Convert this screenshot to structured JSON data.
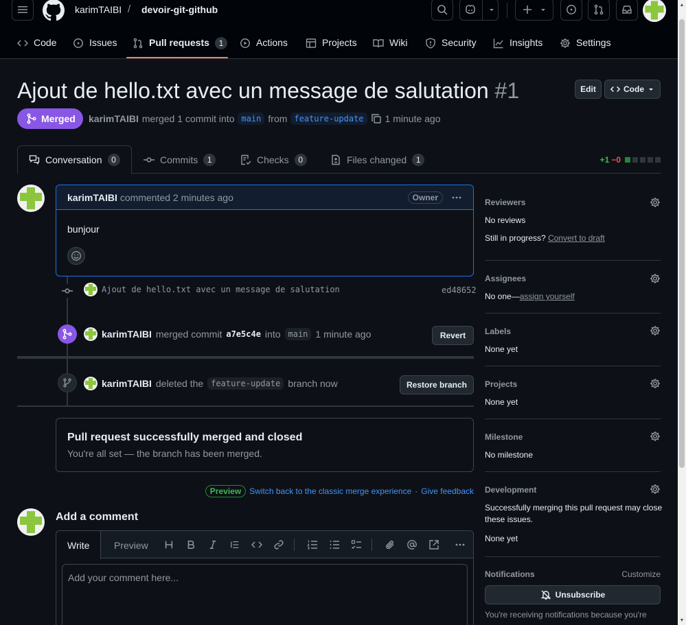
{
  "header": {
    "owner": "karimTAIBI",
    "separator": "/",
    "repo": "devoir-git-github"
  },
  "nav": {
    "items": [
      {
        "label": "Code",
        "icon": "code-icon"
      },
      {
        "label": "Issues",
        "icon": "issue-icon"
      },
      {
        "label": "Pull requests",
        "icon": "pull-request-icon",
        "count": "1"
      },
      {
        "label": "Actions",
        "icon": "play-icon"
      },
      {
        "label": "Projects",
        "icon": "table-icon"
      },
      {
        "label": "Wiki",
        "icon": "book-icon"
      },
      {
        "label": "Security",
        "icon": "shield-icon"
      },
      {
        "label": "Insights",
        "icon": "graph-icon"
      },
      {
        "label": "Settings",
        "icon": "gear-icon"
      }
    ]
  },
  "pr": {
    "title": "Ajout de hello.txt avec un message de salutation",
    "number": "#1",
    "edit_label": "Edit",
    "code_label": "Code",
    "state": "Merged",
    "author": "karimTAIBI",
    "meta_text1": "merged 1 commit into",
    "base_branch": "main",
    "meta_from": "from",
    "head_branch": "feature-update",
    "meta_time": "1 minute ago"
  },
  "tabs": [
    {
      "label": "Conversation",
      "count": "0"
    },
    {
      "label": "Commits",
      "count": "1"
    },
    {
      "label": "Checks",
      "count": "0"
    },
    {
      "label": "Files changed",
      "count": "1"
    }
  ],
  "diffstat": {
    "additions": "+1",
    "deletions": "−0"
  },
  "comment": {
    "author": "karimTAIBI",
    "action": "commented 2 minutes ago",
    "badge": "Owner",
    "body": "bunjour"
  },
  "timeline": {
    "commit_message": "Ajout de hello.txt avec un message de salutation",
    "commit_sha": "ed48652",
    "merge_author": "karimTAIBI",
    "merge_text": "merged commit",
    "merge_sha": "a7e5c4e",
    "merge_into": "into",
    "merge_branch": "main",
    "merge_time": "1 minute ago",
    "revert_label": "Revert",
    "delete_author": "karimTAIBI",
    "delete_text": "deleted the",
    "delete_branch": "feature-update",
    "delete_suffix": "branch now",
    "restore_label": "Restore branch"
  },
  "merged_box": {
    "title": "Pull request successfully merged and closed",
    "subtitle": "You're all set — the branch has been merged."
  },
  "preview": {
    "pill": "Preview",
    "switch_link": "Switch back to the classic merge experience",
    "dot": "·",
    "feedback_link": "Give feedback"
  },
  "add_comment": {
    "title": "Add a comment",
    "write_tab": "Write",
    "preview_tab": "Preview",
    "placeholder": "Add your comment here..."
  },
  "sidebar": {
    "reviewers": {
      "title": "Reviewers",
      "value": "No reviews",
      "progress": "Still in progress?",
      "link": "Convert to draft"
    },
    "assignees": {
      "title": "Assignees",
      "value": "No one—",
      "link": "assign yourself"
    },
    "labels": {
      "title": "Labels",
      "value": "None yet"
    },
    "projects": {
      "title": "Projects",
      "value": "None yet"
    },
    "milestone": {
      "title": "Milestone",
      "value": "No milestone"
    },
    "development": {
      "title": "Development",
      "line1": "Successfully merging this pull request may close",
      "line2": "these issues.",
      "value": "None yet"
    },
    "notifications": {
      "title": "Notifications",
      "customize": "Customize",
      "unsubscribe": "Unsubscribe",
      "reason": "You're receiving notifications because you're"
    }
  },
  "colors": {
    "accent": "#1f6feb",
    "merged": "#8957e5",
    "success": "#238636",
    "link": "#4493f8"
  }
}
